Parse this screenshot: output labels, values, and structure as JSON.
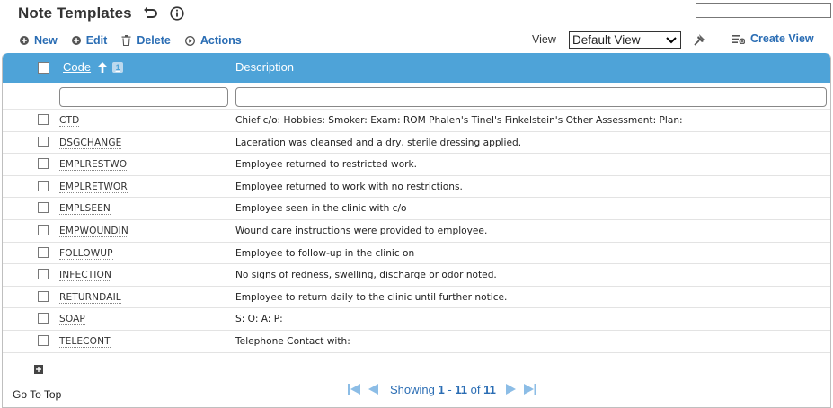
{
  "page": {
    "title": "Note Templates",
    "search_value": ""
  },
  "toolbar": {
    "new_label": "New",
    "edit_label": "Edit",
    "delete_label": "Delete",
    "actions_label": "Actions",
    "view_label": "View",
    "view_selected": "Default View",
    "create_view_label": "Create View"
  },
  "grid": {
    "columns": {
      "code": "Code",
      "description": "Description"
    },
    "sort_badge": "1",
    "filter_code_value": "",
    "filter_desc_value": "",
    "rows": [
      {
        "code": "CTD",
        "description": "Chief c/o: Hobbies: Smoker: Exam: ROM Phalen's Tinel's Finkelstein's Other Assessment: Plan:"
      },
      {
        "code": "DSGCHANGE",
        "description": "Laceration was cleansed and a dry, sterile dressing applied."
      },
      {
        "code": "EMPLRESTWO",
        "description": "Employee returned to restricted work."
      },
      {
        "code": "EMPLRETWOR",
        "description": "Employee returned to work with no restrictions."
      },
      {
        "code": "EMPLSEEN",
        "description": "Employee seen in the clinic with c/o"
      },
      {
        "code": "EMPWOUNDIN",
        "description": "Wound care instructions were provided to employee."
      },
      {
        "code": "FOLLOWUP",
        "description": "Employee to follow-up in the clinic on"
      },
      {
        "code": "INFECTION",
        "description": "No signs of redness, swelling, discharge or odor noted."
      },
      {
        "code": "RETURNDAIL",
        "description": "Employee to return daily to the clinic until further notice."
      },
      {
        "code": "SOAP",
        "description": "S: O: A: P:"
      },
      {
        "code": "TELECONT",
        "description": "Telephone Contact with:"
      }
    ]
  },
  "footer": {
    "go_to_top": "Go To Top",
    "showing_prefix": "Showing",
    "range_start": "1",
    "range_sep": " - ",
    "range_end": "11",
    "of_word": " of ",
    "total": "11"
  },
  "colors": {
    "header_blue": "#4ea3d8",
    "link_blue": "#2a6db4"
  },
  "icons": {
    "undo": "undo-icon",
    "info": "info-icon",
    "new": "plus-circle-icon",
    "edit": "plus-circle-icon",
    "delete": "trash-icon",
    "actions": "play-circle-icon",
    "pin": "pin-icon",
    "create_view": "create-view-icon",
    "expand": "expand-plus-icon",
    "pager_first": "first-page-icon",
    "pager_prev": "prev-page-icon",
    "pager_next": "next-page-icon",
    "pager_last": "last-page-icon"
  }
}
